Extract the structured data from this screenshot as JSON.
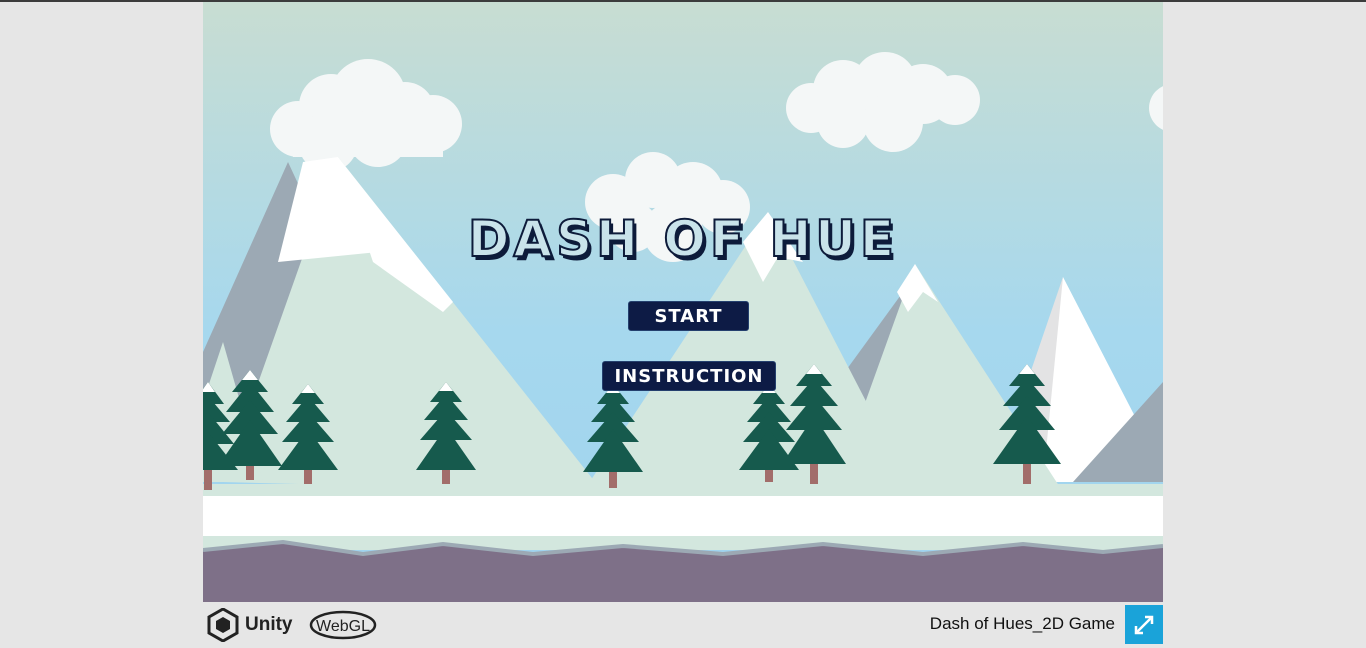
{
  "game": {
    "title_text": "DASH OF HUE",
    "buttons": {
      "start": "START",
      "instruction": "INSTRUCTION"
    }
  },
  "footer": {
    "engine_label": "Unity",
    "webgl_label": "WebGL",
    "game_name": "Dash of Hues_2D Game",
    "fullscreen_icon": "expand-arrows-icon"
  },
  "colors": {
    "sky_top": "#c8ddd2",
    "sky_bottom": "#a3d6ef",
    "mountain_gray": "#9ca9b4",
    "mountain_light": "#d3e7de",
    "snow": "#ffffff",
    "tree": "#165a4d",
    "trunk": "#a26d6a",
    "ground_purple": "#7e7088",
    "button_bg": "#0d1b45",
    "fullscreen_bg": "#1aa3d9"
  }
}
